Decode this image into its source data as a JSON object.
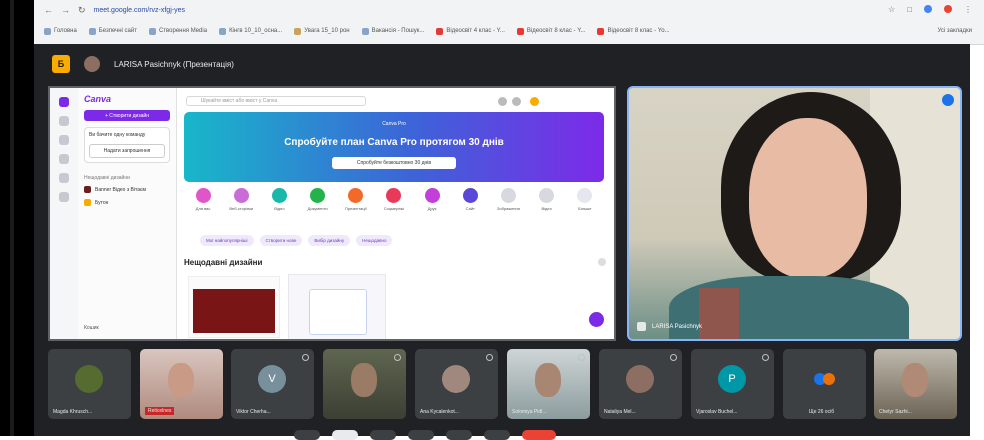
{
  "browser": {
    "url": "meet.google.com/rvz-xfgj-yes",
    "bookmarks": [
      "Головна",
      "Безпечні сайт",
      "Створення Media",
      "Кiнгв 10_10_осна...",
      "Увага 15_10 рон",
      "Вакансiя - Пошук...",
      "Вiдеосвiт 4 клас - Y...",
      "Вiдеосвiт 8 клас - Y...",
      "Вiдеосвiт 8 клас - Yo..."
    ],
    "right_label": "Усi закладки"
  },
  "meet": {
    "logo": "Б",
    "presenter_title": "LARISA Pasichnyk (Презентація)",
    "shared_screen": {
      "brand": "Canva",
      "create_label": "+ Створити дизайн",
      "card_text": "Ви бачите одну команду",
      "card_button": "Надати запрошення",
      "recent_label": "Нещодавні дизайни",
      "recent_items": [
        "Banner Вiдео з Вiтаєм",
        "Бутон"
      ],
      "trash_label": "Кошик",
      "search_placeholder": "Шукайте вміст або вміст у Canva",
      "banner_tag": "Canva Pro",
      "banner_title": "Спробуйте план Canva Pro протягом 30 днів",
      "banner_button": "Спробуйте безкоштовно 30 днів",
      "categories": [
        "Для вас",
        "Веб-сторінки",
        "Відео",
        "Документи",
        "Презентації",
        "Соцмережі",
        "Друк",
        "Сайт",
        "Зображення",
        "Відео",
        "Більше"
      ],
      "chips": [
        "Мої найпопулярніші",
        "Створити нове",
        "Вибір дизайну",
        "Нещодавно"
      ],
      "recent_designs_title": "Нещодавні дизайни"
    },
    "speaker_name": "LARISA Pasichnyk",
    "participants": [
      {
        "initials": "",
        "name": "Magda Khrusch...",
        "style": "dark"
      },
      {
        "initials": "",
        "name": "Reticelnes",
        "style": "photo1"
      },
      {
        "initials": "V",
        "name": "Viktor Cherha...",
        "style": "dark"
      },
      {
        "initials": "",
        "name": "",
        "style": "photo2"
      },
      {
        "initials": "",
        "name": "Ana Kycalenkot...",
        "style": "dark"
      },
      {
        "initials": "",
        "name": "Solomiya Pidl...",
        "style": "photo3"
      },
      {
        "initials": "",
        "name": "Nataliya Mel...",
        "style": "dark"
      },
      {
        "initials": "P",
        "name": "Vjaroslav Buchel...",
        "style": "dark"
      },
      {
        "initials": "",
        "name": "Ще 26 осіб",
        "style": "dark"
      },
      {
        "initials": "",
        "name": "Chetyr Sazhi...",
        "style": "photo4"
      }
    ]
  }
}
